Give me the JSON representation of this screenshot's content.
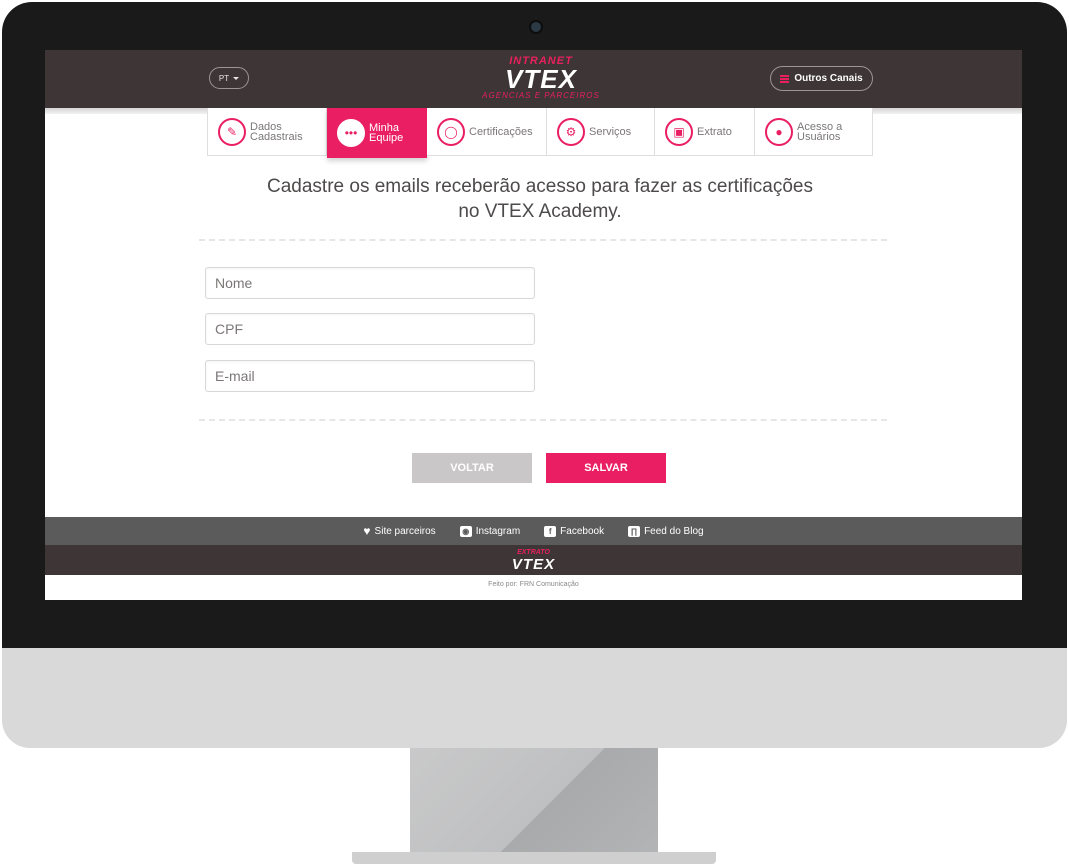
{
  "header": {
    "language": "PT",
    "logo": {
      "top": "INTRANET",
      "main": "VTEX",
      "sub": "AGENCIAS E PARCEIROS"
    },
    "menu_button": "Outros Canais"
  },
  "tabs": [
    {
      "label": "Dados\nCadastrais",
      "icon": "edit-icon",
      "active": false
    },
    {
      "label": "Minha\nEquipe",
      "icon": "team-icon",
      "active": true
    },
    {
      "label": "Certificações",
      "icon": "badge-icon",
      "active": false
    },
    {
      "label": "Serviços",
      "icon": "gear-icon",
      "active": false
    },
    {
      "label": "Extrato",
      "icon": "document-icon",
      "active": false
    },
    {
      "label": "Acesso a\nUsuários",
      "icon": "user-icon",
      "active": false
    }
  ],
  "main": {
    "headline_line1": "Cadastre os emails receberão acesso para fazer as certificações",
    "headline_line2": "no VTEX Academy.",
    "fields": {
      "name_placeholder": "Nome",
      "cpf_placeholder": "CPF",
      "email_placeholder": "E-mail"
    },
    "back_label": "VOLTAR",
    "save_label": "SALVAR"
  },
  "footer": {
    "links": [
      {
        "label": "Site parceiros",
        "icon": "heart-icon"
      },
      {
        "label": "Instagram",
        "icon": "instagram-icon"
      },
      {
        "label": "Facebook",
        "icon": "facebook-icon"
      },
      {
        "label": "Feed do Blog",
        "icon": "rss-icon"
      }
    ],
    "logo_top": "EXTRATO",
    "logo_main": "VTEX",
    "credit": "Feito por: FRN Comunicação"
  },
  "colors": {
    "accent": "#ea1e63",
    "header_bg": "#3d3536",
    "footer_bg": "#5c5b5b"
  }
}
